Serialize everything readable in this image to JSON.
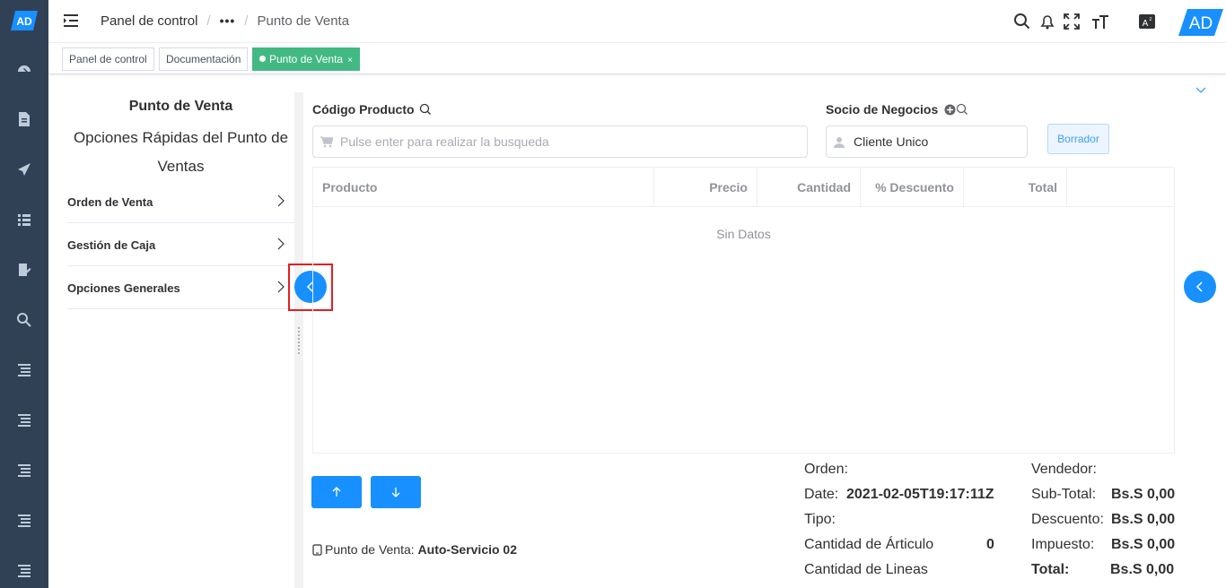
{
  "sidebar": {
    "logo_text": "AD",
    "items": [
      "dashboard-icon",
      "document-icon",
      "send-icon",
      "list-icon",
      "edit-document-icon",
      "search-icon",
      "tree-list-icon",
      "tree-list-icon",
      "tree-list-icon",
      "tree-list-icon",
      "tree-list-icon"
    ]
  },
  "header": {
    "breadcrumb": {
      "home": "Panel de control",
      "ellipsis": "•••",
      "current": "Punto de Venta",
      "separator": "/"
    },
    "avatar_text": "AD"
  },
  "tags": [
    {
      "label": "Panel de control",
      "active": false
    },
    {
      "label": "Documentación",
      "active": false
    },
    {
      "label": "Punto de Venta",
      "active": true,
      "close": "×"
    }
  ],
  "left_panel": {
    "title": "Punto de Venta",
    "subtitle": "Opciones Rápidas del Punto de Ventas",
    "menu": [
      "Orden de Venta",
      "Gestión de Caja",
      "Opciones Generales"
    ]
  },
  "form": {
    "product_code_label": "Código Producto",
    "product_placeholder": "Pulse enter para realizar la busqueda",
    "partner_label": "Socio de Negocios",
    "partner_value": "Cliente Unico",
    "clear_button": "Borrador"
  },
  "table": {
    "columns": [
      "Producto",
      "Precio",
      "Cantidad",
      "% Descuento",
      "Total"
    ],
    "empty_text": "Sin Datos"
  },
  "footer": {
    "pos_label": "Punto de Venta:",
    "pos_value": "Auto-Servicio 02",
    "order_label": "Orden:",
    "date_label": "Date:",
    "date_value": "2021-02-05T19:17:11Z",
    "type_label": "Tipo:",
    "qty_articles_label": "Cantidad de Árticulo",
    "qty_articles_value": "0",
    "qty_lines_label": "Cantidad de Lineas",
    "seller_label": "Vendedor:",
    "subtotal_label": "Sub-Total:",
    "subtotal_value": "Bs.S 0,00",
    "discount_label": "Descuento:",
    "discount_value": "Bs.S 0,00",
    "tax_label": "Impuesto:",
    "tax_value": "Bs.S 0,00",
    "total_label": "Total:",
    "total_value": "Bs.S 0,00"
  },
  "colors": {
    "sidebar_bg": "#304156",
    "primary": "#1890ff",
    "tag_active": "#42b983",
    "highlight": "#e02020"
  }
}
